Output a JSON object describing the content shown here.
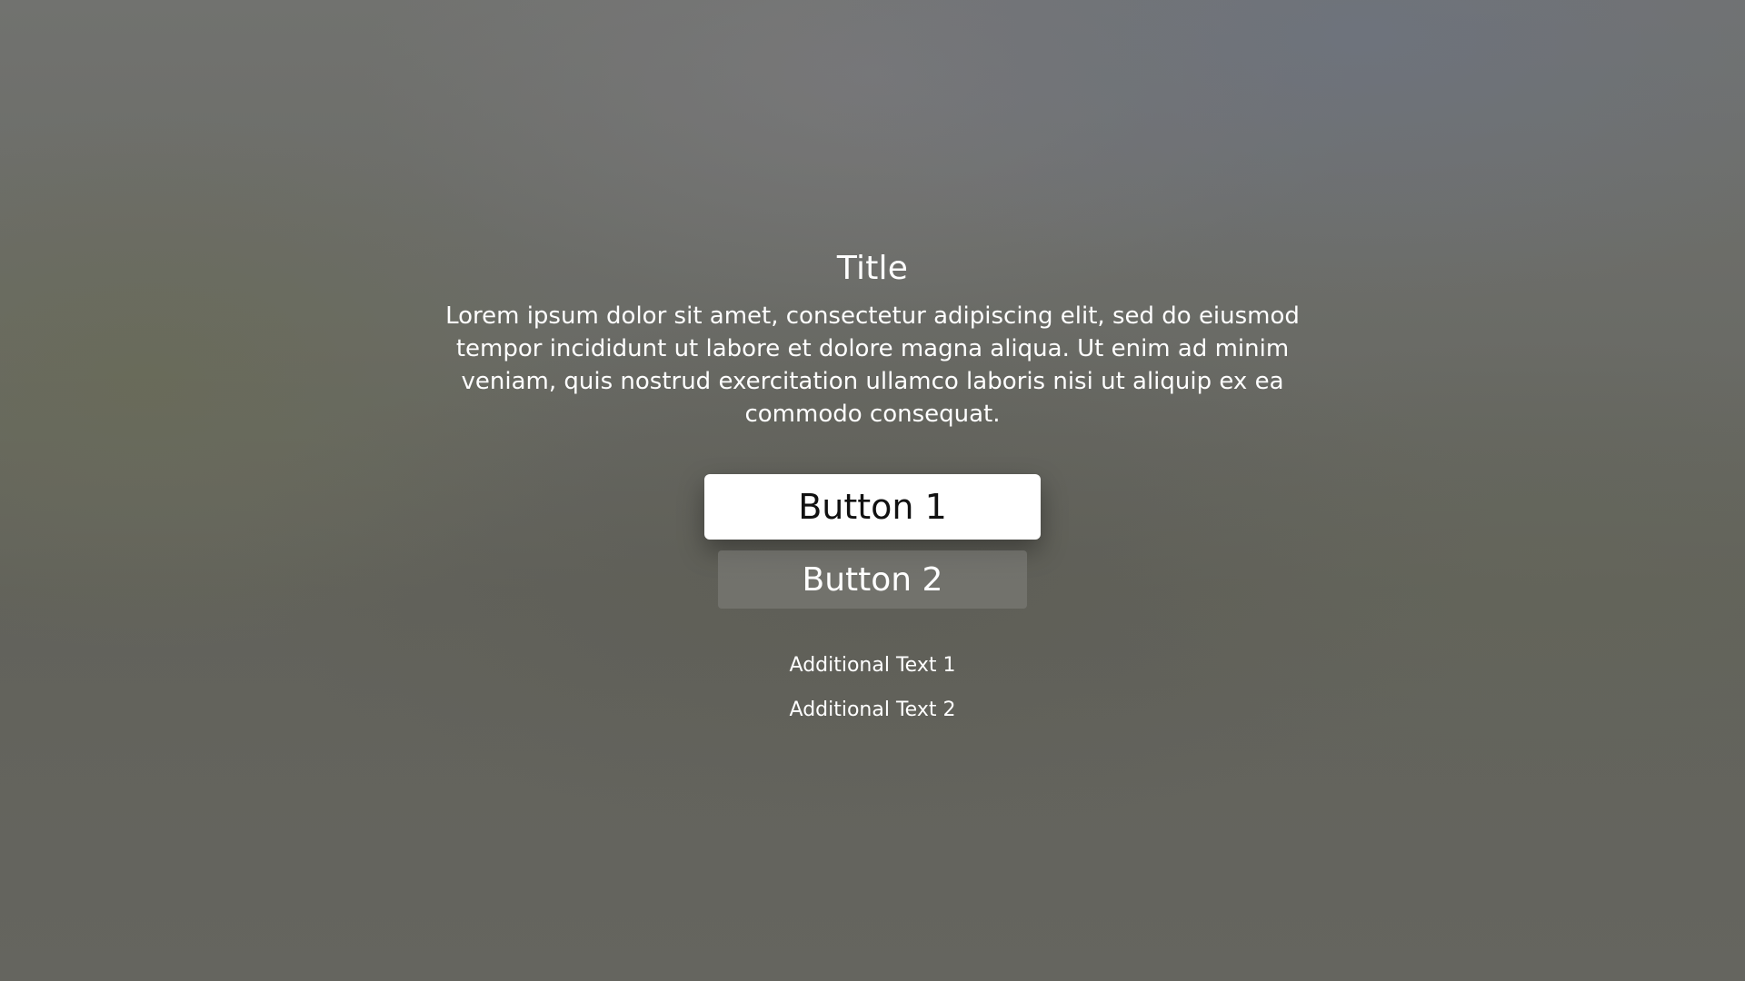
{
  "dialog": {
    "title": "Title",
    "message": "Lorem ipsum dolor sit amet, consectetur adipiscing elit, sed do eiusmod tempor incididunt ut labore et dolore magna aliqua. Ut enim ad minim veniam, quis nostrud exercitation ullamco laboris nisi ut aliquip ex ea commodo consequat.",
    "buttons": [
      {
        "label": "Button 1",
        "focused": true
      },
      {
        "label": "Button 2",
        "focused": false
      }
    ],
    "additional_text": [
      "Additional Text 1",
      "Additional Text 2"
    ]
  },
  "colors": {
    "background": "#656560",
    "focused_button": "#ffffff",
    "focused_button_text": "#111111",
    "unfocused_button": "#7d7d78",
    "text": "#ffffff"
  }
}
